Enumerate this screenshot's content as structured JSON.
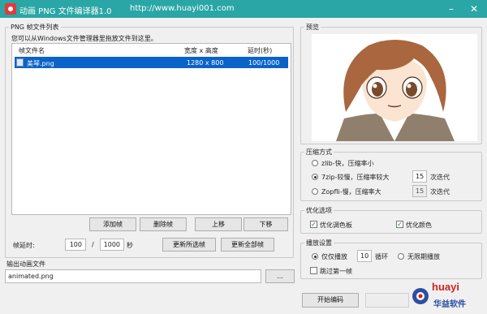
{
  "window": {
    "title": "动画 PNG 文件编译器1.0",
    "url": "http://www.huayi001.com"
  },
  "frames_panel": {
    "legend": "PNG 帧文件列表",
    "hint": "您可以从Windows文件管理器里拖放文件到这里。",
    "columns": [
      "帧文件名",
      "宽度 x 高度",
      "延时(秒)"
    ],
    "rows": [
      {
        "name": "美琴.png",
        "size": "1280 x 800",
        "delay": "100/1000"
      }
    ],
    "buttons": {
      "add": "添加帧",
      "delete": "删除帧",
      "up": "上移",
      "down": "下移"
    },
    "delay_label": "帧延时:",
    "delay_num": "100",
    "delay_sep": "/",
    "delay_den": "1000",
    "delay_unit": "秒",
    "update_selected": "更新所选帧",
    "update_all": "更新全部帧"
  },
  "output": {
    "legend": "输出动画文件",
    "filename": "animated.png",
    "browse": "..."
  },
  "preview": {
    "legend": "预览"
  },
  "compression": {
    "legend": "压缩方式",
    "options": [
      {
        "label": "zlib-快，压缩率小",
        "selected": false
      },
      {
        "label": "7zip-较慢，压缩率较大",
        "selected": true,
        "iterations": "15",
        "iter_label": "次迭代"
      },
      {
        "label": "Zopfli-慢，压缩率大",
        "selected": false,
        "iterations": "15",
        "iter_label": "次迭代"
      }
    ]
  },
  "optimize": {
    "legend": "优化选项",
    "palette": {
      "label": "优化调色板",
      "checked": true
    },
    "color": {
      "label": "优化颜色",
      "checked": true
    }
  },
  "playback": {
    "legend": "播放设置",
    "play_only": "仅仅播放",
    "loops": "10",
    "loop_label": "循环",
    "infinite": "无限期播放",
    "skip_first": "跳过第一帧"
  },
  "actions": {
    "start": "开始编码"
  },
  "watermark": {
    "brand": "huayi",
    "sub": "华益软件"
  },
  "colors": {
    "titlebar": "#2aa6a6",
    "selection": "#0a63c9"
  }
}
